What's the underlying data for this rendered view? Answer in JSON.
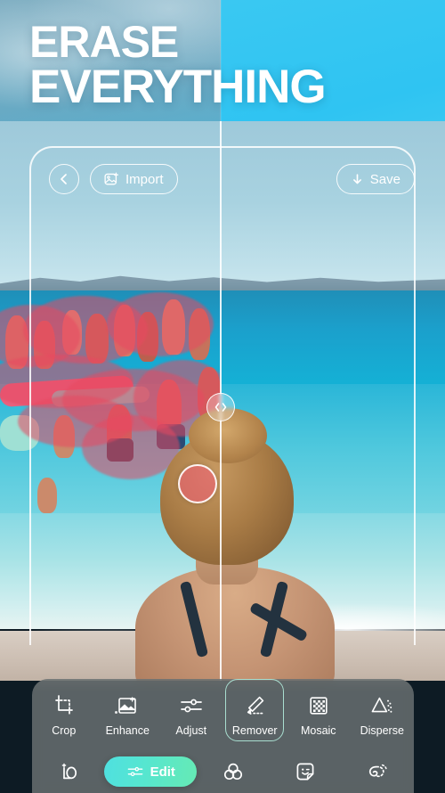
{
  "promo": {
    "line1": "ERASE",
    "line2": "EVERYTHING"
  },
  "header": {
    "back_icon": "chevron-left-icon",
    "import_label": "Import",
    "import_icon": "image-add-icon",
    "save_label": "Save",
    "save_icon": "download-arrow-icon"
  },
  "canvas": {
    "compare_handle_icon": "compare-slider-icon",
    "brush_indicator": "brush-circle",
    "brush_color": "#eb5f73",
    "mask_color": "#e84860"
  },
  "toolbar": {
    "selected": "Remover",
    "selection_color": "#a9ded0",
    "tools": [
      {
        "label": "Crop",
        "icon": "crop-icon"
      },
      {
        "label": "Enhance",
        "icon": "enhance-image-icon"
      },
      {
        "label": "Adjust",
        "icon": "sliders-icon"
      },
      {
        "label": "Remover",
        "icon": "eraser-pen-icon"
      },
      {
        "label": "Mosaic",
        "icon": "mosaic-grid-icon"
      },
      {
        "label": "Disperse",
        "icon": "disperse-triangle-icon"
      }
    ]
  },
  "nav": {
    "accent_from": "#4fe0e0",
    "accent_to": "#66eab4",
    "items": [
      {
        "label": "",
        "icon": "ai-portrait-icon",
        "active": false
      },
      {
        "label": "Edit",
        "icon": "sliders-icon",
        "active": true
      },
      {
        "label": "",
        "icon": "filters-circles-icon",
        "active": false
      },
      {
        "label": "",
        "icon": "sticker-smiley-icon",
        "active": false
      },
      {
        "label": "",
        "icon": "retouch-swirl-icon",
        "active": false
      }
    ]
  }
}
